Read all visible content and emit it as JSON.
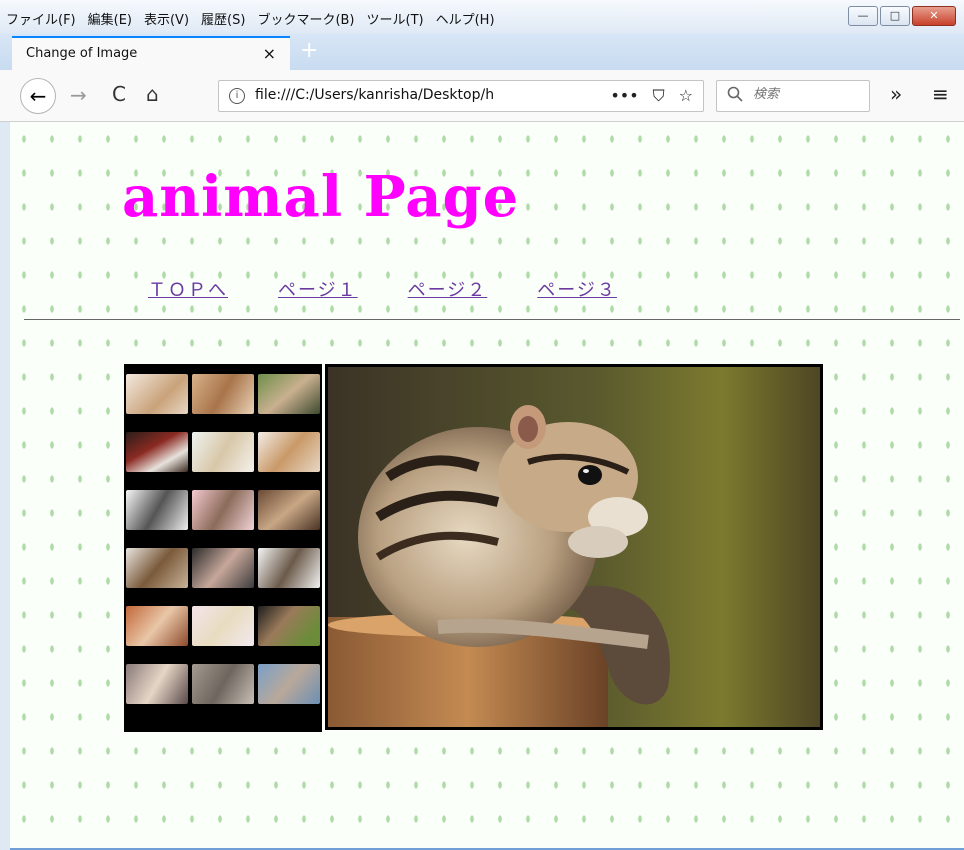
{
  "menubar": {
    "items": [
      "ファイル(F)",
      "編集(E)",
      "表示(V)",
      "履歴(S)",
      "ブックマーク(B)",
      "ツール(T)",
      "ヘルプ(H)"
    ]
  },
  "window_controls": {
    "minimize": "—",
    "maximize": "□",
    "close": "✕"
  },
  "tab": {
    "title": "Change of Image",
    "close": "×",
    "new_tab": "+"
  },
  "navbar": {
    "back": "←",
    "forward": "→",
    "reload": "C",
    "home": "⌂",
    "info": "i",
    "url": "file:///C:/Users/kanrisha/Desktop/h",
    "url_actions": [
      "•••",
      "⛉",
      "☆"
    ],
    "search_placeholder": "検索",
    "overflow": "»",
    "menu": "≡"
  },
  "page": {
    "title": "animal Page",
    "nav": [
      "ＴＯＰへ",
      "ページ１",
      "ページ２",
      "ページ３"
    ]
  },
  "thumbnails": [
    "puppy-and-kitten",
    "puppy-kitten-lying",
    "cats-on-branch",
    "christmas-pets",
    "puppy-kitten-blanket",
    "rabbit",
    "kittens-black-white",
    "kittens-group-pink",
    "sugar-gliders",
    "kittens-tabby",
    "kitten-in-basket",
    "kittens-row",
    "fennec-fox",
    "white-puppy-kitten",
    "squirrel-on-grass",
    "hamster-with-flower",
    "chinchilla",
    "hamster-close-up"
  ],
  "main_image": "chipmunk-on-stump"
}
